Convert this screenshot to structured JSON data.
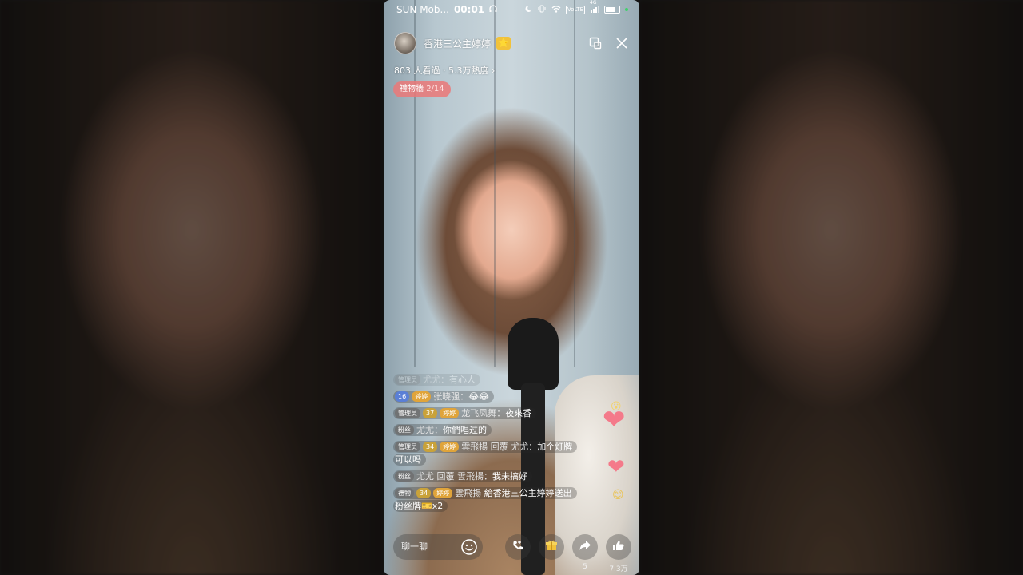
{
  "status_bar": {
    "carrier": "SUN Mob...",
    "time": "00:01",
    "icons": [
      "headphones-icon",
      "moon-icon",
      "vibrate-icon",
      "wifi-icon",
      "volte-icon",
      "signal-icon",
      "battery-icon"
    ],
    "volte_label": "VoLTE",
    "network_label": "4G"
  },
  "host": {
    "name": "香港三公主婷婷",
    "badge": "⭐",
    "stats": "803 人看過 · 5.3万熱度 ›"
  },
  "gift_wall": {
    "label": "禮物牆",
    "count": "2/14"
  },
  "chat": [
    {
      "tags": [
        {
          "type": "admin",
          "text": "管理员"
        }
      ],
      "user": "尤尤",
      "sep": "：",
      "text": "有心人",
      "faded": true
    },
    {
      "tags": [
        {
          "type": "level",
          "text": "16"
        },
        {
          "type": "fanclub",
          "text": "婷婷"
        }
      ],
      "user": "张晓强",
      "sep": "：",
      "text": "😂😂"
    },
    {
      "tags": [
        {
          "type": "admin",
          "text": "管理员"
        },
        {
          "type": "lvgold",
          "text": "37"
        },
        {
          "type": "fanclub",
          "text": "婷婷"
        }
      ],
      "user": "龙飞凤舞",
      "sep": "：",
      "text": "夜來香"
    },
    {
      "tags": [
        {
          "type": "fan",
          "text": "粉丝"
        }
      ],
      "user": "尤尤",
      "sep": "：",
      "text": "你們唱过的"
    },
    {
      "tags": [
        {
          "type": "admin",
          "text": "管理员"
        },
        {
          "type": "lvgold",
          "text": "34"
        },
        {
          "type": "fanclub",
          "text": "婷婷"
        }
      ],
      "user": "雲飛揚 回覆 尤尤",
      "sep": "：",
      "text": "加个灯牌 可以吗"
    },
    {
      "tags": [
        {
          "type": "fan",
          "text": "粉丝"
        }
      ],
      "user": "尤尤 回覆 雲飛揚",
      "sep": "：",
      "text": "我未搞好"
    },
    {
      "tags": [
        {
          "type": "gift",
          "text": "禮物"
        },
        {
          "type": "lvgold",
          "text": "34"
        },
        {
          "type": "fanclub",
          "text": "婷婷"
        }
      ],
      "user": "雲飛揚",
      "sep": " ",
      "text": "給香港三公主婷婷送出粉丝牌🎫x2"
    }
  ],
  "bottom_bar": {
    "input_placeholder": "聊一聊",
    "share_count": "5",
    "like_count": "7.3万"
  },
  "colors": {
    "gift_wall_bg": "#eb7878",
    "badge_gold": "#f2c23a",
    "heart": "#f47a8a"
  }
}
